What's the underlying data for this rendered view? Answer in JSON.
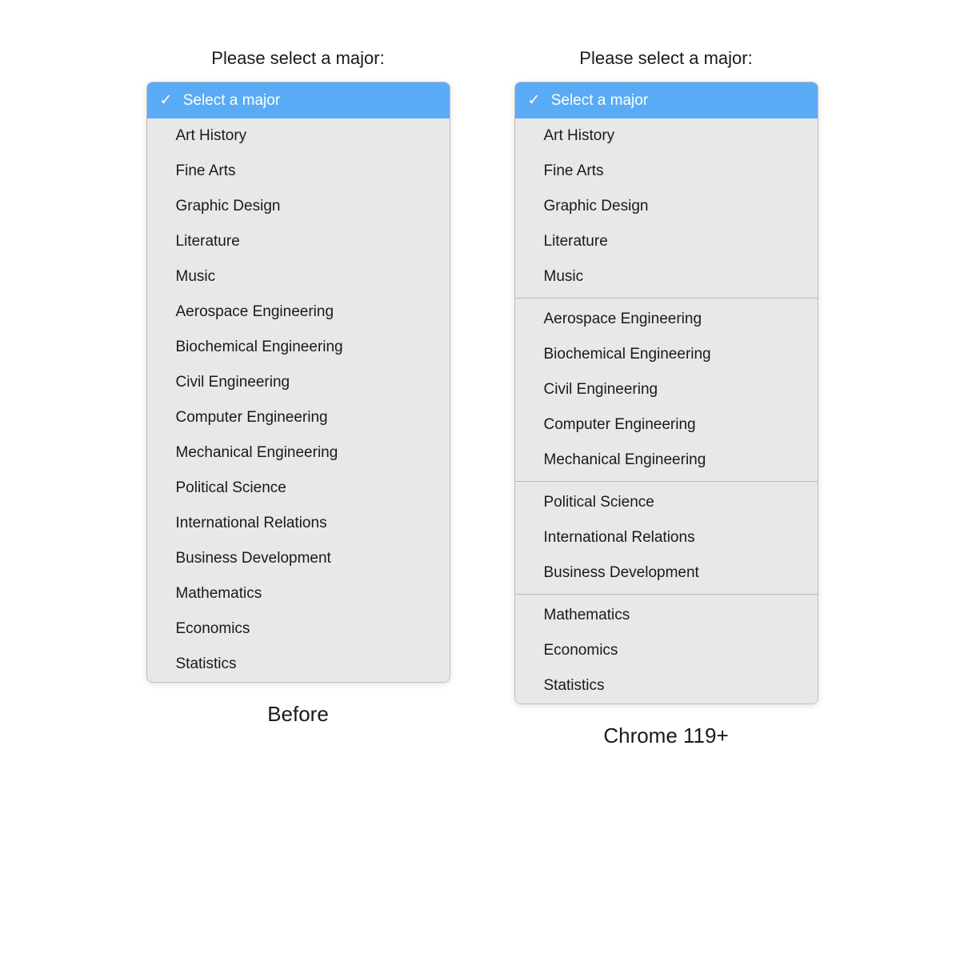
{
  "page": {
    "before_label": "Please select a major:",
    "after_label": "Please select a major:",
    "before_caption": "Before",
    "after_caption": "Chrome 119+",
    "select_placeholder": "Select a major",
    "accent_color": "#5aabf5"
  },
  "majors_flat": [
    {
      "id": "select-major",
      "label": "Select a major",
      "selected": true
    },
    {
      "id": "art-history",
      "label": "Art History"
    },
    {
      "id": "fine-arts",
      "label": "Fine Arts"
    },
    {
      "id": "graphic-design",
      "label": "Graphic Design"
    },
    {
      "id": "literature",
      "label": "Literature"
    },
    {
      "id": "music",
      "label": "Music"
    },
    {
      "id": "aerospace-engineering",
      "label": "Aerospace Engineering"
    },
    {
      "id": "biochemical-engineering",
      "label": "Biochemical Engineering"
    },
    {
      "id": "civil-engineering",
      "label": "Civil Engineering"
    },
    {
      "id": "computer-engineering",
      "label": "Computer Engineering"
    },
    {
      "id": "mechanical-engineering",
      "label": "Mechanical Engineering"
    },
    {
      "id": "political-science",
      "label": "Political Science"
    },
    {
      "id": "international-relations",
      "label": "International Relations"
    },
    {
      "id": "business-development",
      "label": "Business Development"
    },
    {
      "id": "mathematics",
      "label": "Mathematics"
    },
    {
      "id": "economics",
      "label": "Economics"
    },
    {
      "id": "statistics",
      "label": "Statistics"
    }
  ],
  "majors_grouped": {
    "selected": {
      "id": "select-major",
      "label": "Select a major"
    },
    "groups": [
      {
        "id": "arts",
        "items": [
          {
            "id": "art-history",
            "label": "Art History"
          },
          {
            "id": "fine-arts",
            "label": "Fine Arts"
          },
          {
            "id": "graphic-design",
            "label": "Graphic Design"
          },
          {
            "id": "literature",
            "label": "Literature"
          },
          {
            "id": "music",
            "label": "Music"
          }
        ]
      },
      {
        "id": "engineering",
        "items": [
          {
            "id": "aerospace-engineering",
            "label": "Aerospace Engineering"
          },
          {
            "id": "biochemical-engineering",
            "label": "Biochemical Engineering"
          },
          {
            "id": "civil-engineering",
            "label": "Civil Engineering"
          },
          {
            "id": "computer-engineering",
            "label": "Computer Engineering"
          },
          {
            "id": "mechanical-engineering",
            "label": "Mechanical Engineering"
          }
        ]
      },
      {
        "id": "social-sciences",
        "items": [
          {
            "id": "political-science",
            "label": "Political Science"
          },
          {
            "id": "international-relations",
            "label": "International Relations"
          },
          {
            "id": "business-development",
            "label": "Business Development"
          }
        ]
      },
      {
        "id": "math-econ",
        "items": [
          {
            "id": "mathematics",
            "label": "Mathematics"
          },
          {
            "id": "economics",
            "label": "Economics"
          },
          {
            "id": "statistics",
            "label": "Statistics"
          }
        ]
      }
    ]
  }
}
